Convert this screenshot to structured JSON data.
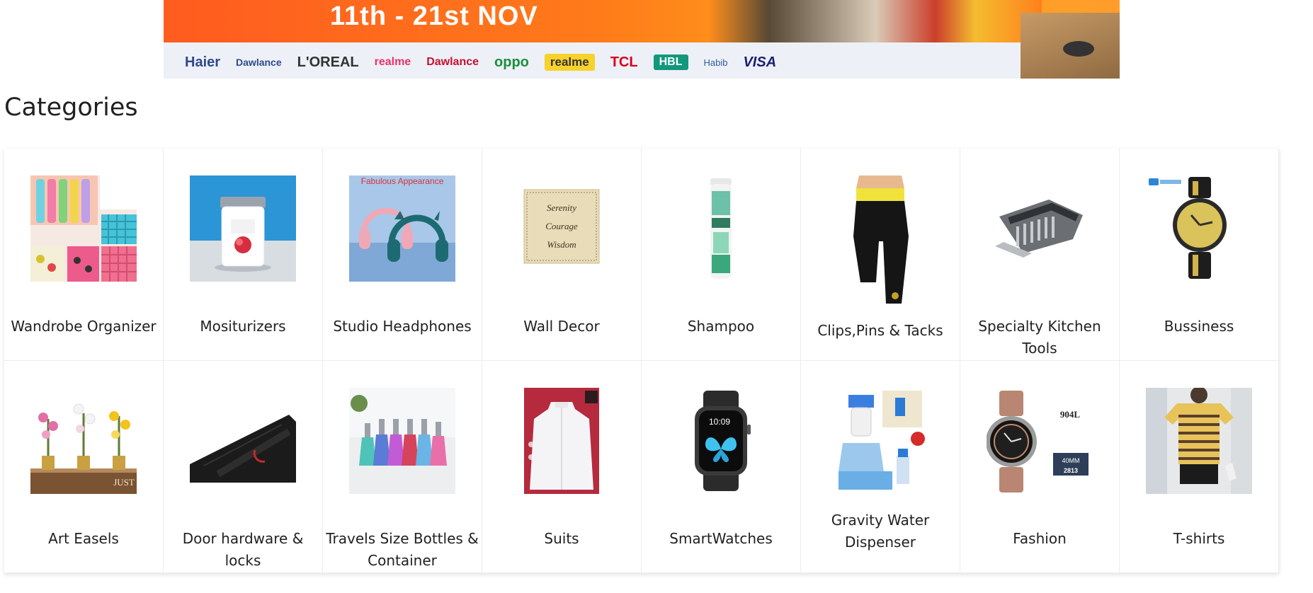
{
  "banner": {
    "date_text": "11th - 21st NOV",
    "brands": [
      "Haier",
      "Dawlance",
      "L'OREAL",
      "realme",
      "Dawlance",
      "oppo",
      "realme",
      "TCL",
      "HBL",
      "Habib",
      "VISA"
    ]
  },
  "heading": "Categories",
  "categories": [
    {
      "label": "Wandrobe Organizer",
      "icon": "organizer-icon"
    },
    {
      "label": "Mositurizers",
      "icon": "moisturizer-jar-icon"
    },
    {
      "label": "Studio Headphones",
      "icon": "headphones-icon",
      "thumb_text": "Fabulous Appearance"
    },
    {
      "label": "Wall Decor",
      "icon": "wall-plaque-icon",
      "thumb_text": [
        "Serenity",
        "Courage",
        "Wisdom"
      ]
    },
    {
      "label": "Shampoo",
      "icon": "shampoo-bottle-icon"
    },
    {
      "label": "Clips,Pins & Tacks",
      "icon": "leggings-icon"
    },
    {
      "label": "Specialty Kitchen Tools",
      "icon": "kitchen-slicer-icon"
    },
    {
      "label": "Bussiness",
      "icon": "wrist-watch-icon"
    },
    {
      "label": "Art Easels",
      "icon": "orchid-plants-icon",
      "thumb_text": "JUST"
    },
    {
      "label": "Door hardware & locks",
      "icon": "door-handle-icon"
    },
    {
      "label": "Travels Size Bottles & Container",
      "icon": "perfume-bottles-icon"
    },
    {
      "label": "Suits",
      "icon": "kurta-suit-icon"
    },
    {
      "label": "SmartWatches",
      "icon": "smartwatch-icon",
      "thumb_text": "10:09"
    },
    {
      "label": "Gravity Water Dispenser",
      "icon": "water-pump-icon"
    },
    {
      "label": "Fashion",
      "icon": "luxury-watch-icon",
      "thumb_text": [
        "904L",
        "40MM",
        "2813"
      ]
    },
    {
      "label": "T-shirts",
      "icon": "tshirt-model-icon"
    }
  ]
}
